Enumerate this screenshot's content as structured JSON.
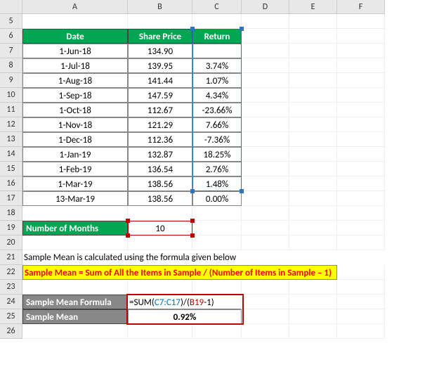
{
  "cols": [
    "A",
    "B",
    "C",
    "D",
    "E",
    "F"
  ],
  "rows_visible": [
    5,
    6,
    7,
    8,
    9,
    10,
    11,
    12,
    13,
    14,
    15,
    16,
    17,
    18,
    19,
    20,
    21,
    22,
    23,
    24,
    25,
    26
  ],
  "table": {
    "headers": {
      "date": "Date",
      "price": "Share Price",
      "return": "Return"
    },
    "rows": [
      {
        "date": "1-Jun-18",
        "price": "134.90",
        "return": ""
      },
      {
        "date": "1-Jul-18",
        "price": "139.95",
        "return": "3.74%"
      },
      {
        "date": "1-Aug-18",
        "price": "141.44",
        "return": "1.07%"
      },
      {
        "date": "1-Sep-18",
        "price": "147.59",
        "return": "4.34%"
      },
      {
        "date": "1-Oct-18",
        "price": "112.67",
        "return": "-23.66%"
      },
      {
        "date": "1-Nov-18",
        "price": "121.29",
        "return": "7.66%"
      },
      {
        "date": "1-Dec-18",
        "price": "112.36",
        "return": "-7.36%"
      },
      {
        "date": "1-Jan-19",
        "price": "132.87",
        "return": "18.25%"
      },
      {
        "date": "1-Feb-19",
        "price": "136.54",
        "return": "2.76%"
      },
      {
        "date": "1-Mar-19",
        "price": "138.56",
        "return": "1.48%"
      },
      {
        "date": "13-Mar-19",
        "price": "138.56",
        "return": "0.00%"
      }
    ]
  },
  "months": {
    "label": "Number of Months",
    "value": "10"
  },
  "note": "Sample Mean is calculated using the formula given below",
  "formula_desc": "Sample Mean = Sum of All the Items in Sample / (Number of Items in Sample – 1)",
  "formula": {
    "label_formula": "Sample Mean Formula",
    "label_result": "Sample Mean",
    "eq": "=",
    "fn": "SUM",
    "open": "(",
    "range": "C7:C17",
    "close_div": ")/(",
    "ref": "B19",
    "minus": "-1)",
    "result": "0.92%"
  }
}
